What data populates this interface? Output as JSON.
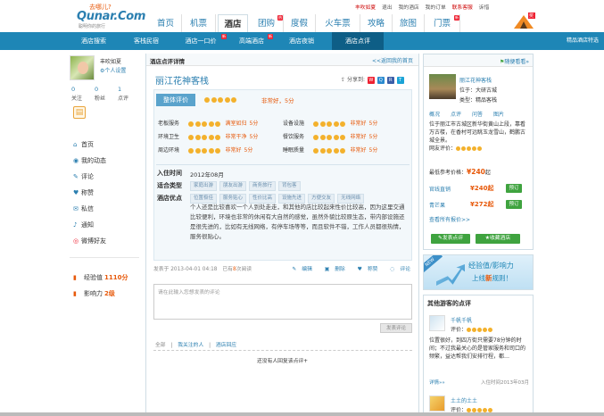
{
  "header": {
    "logo_small": "去哪儿?",
    "logo_main": "Qunar.Com",
    "logo_slogan": "聪明你的旅行",
    "top_links": [
      "丰吹如夏",
      "退出",
      "我的酒店",
      "我的订单",
      "联系客服",
      "诉惜"
    ],
    "nav": [
      {
        "label": "首页",
        "badge": ""
      },
      {
        "label": "机票",
        "badge": ""
      },
      {
        "label": "酒店",
        "badge": ""
      },
      {
        "label": "团购",
        "badge": "热"
      },
      {
        "label": "度假",
        "badge": ""
      },
      {
        "label": "火车票",
        "badge": ""
      },
      {
        "label": "攻略",
        "badge": ""
      },
      {
        "label": "旅图",
        "badge": ""
      },
      {
        "label": "门票",
        "badge": "新"
      }
    ],
    "tent_badge": "奖"
  },
  "subnav": {
    "items": [
      "酒店搜索",
      "客栈民宿",
      "酒店一口价",
      "高端酒店",
      "酒店夜销",
      "酒店点评"
    ],
    "badges": {
      "2": "新",
      "3": "新"
    },
    "right_link": "精品酒店特选"
  },
  "left": {
    "username": "丰吹如夏",
    "settings": "个人设置",
    "stats": [
      {
        "num": "0",
        "label": "关注"
      },
      {
        "num": "0",
        "label": "粉丝"
      },
      {
        "num": "1",
        "label": "点评"
      }
    ],
    "nav": [
      "首页",
      "我的动态",
      "评论",
      "称赞",
      "私信",
      "通知",
      "微博好友"
    ],
    "scores": [
      {
        "label": "经验值",
        "value": "1110分"
      },
      {
        "label": "影响力",
        "value": "2级"
      }
    ]
  },
  "main": {
    "title": "酒店点评详情",
    "back": "<<返回我的首页",
    "hotel_name": "丽江花神客栈",
    "share_label": "分享到:",
    "overall_label": "整体评价",
    "overall_text": "非常好，5分",
    "ratings": [
      {
        "label": "老板服务",
        "cmt": "满室如归",
        "score": "5分"
      },
      {
        "label": "设备设施",
        "cmt": "非常好",
        "score": "5分"
      },
      {
        "label": "环境卫生",
        "cmt": "非常干净",
        "score": "5分"
      },
      {
        "label": "餐饮服务",
        "cmt": "非常好",
        "score": "5分"
      },
      {
        "label": "周边环境",
        "cmt": "非常好",
        "score": "5分"
      },
      {
        "label": "睡眠质量",
        "cmt": "非常好",
        "score": "5分"
      }
    ],
    "checkin_label": "入住时间",
    "checkin_value": "2012年08月",
    "suitable_label": "适合类型",
    "suitable_tags": [
      "家庭出游",
      "朋友出游",
      "商务旅行",
      "背包客"
    ],
    "pros_label": "酒店优点",
    "pros_tags": [
      "位置极佳",
      "服务贴心",
      "性价比高",
      "设施先进",
      "方便交友",
      "无线网络"
    ],
    "review_text": "个人还是比较喜欢一个人到处走走，和其他的店比较起来性价比较高，因为这里交通比较便利，环境也非常的休闲有大自然的感觉，虽然外貌比较原生态，带内部设施还是很先进的，比如有无线网络，有停车场等等，而且软件不错，工作人员都很热情，服务很贴心。",
    "meta_published": "发表于 2013-04-01 04:18",
    "meta_views_prefix": "已有",
    "meta_views": "8",
    "meta_views_suffix": "次阅读",
    "actions": [
      "编辑",
      "删除",
      "称赞",
      "评论"
    ],
    "comment_placeholder": "请在此输入您想发表的评论",
    "submit": "发表评论",
    "filters": [
      "全部",
      "我关注的人",
      "酒店回应"
    ],
    "no_reply": "还没有人回复该点评+"
  },
  "right": {
    "head_left": "",
    "head_right": "随便看看»",
    "hotel": {
      "name": "丽江花神客栈",
      "location": "位于：大研古城",
      "type": "类型：精品客栈"
    },
    "tabs": [
      "概况",
      "点评",
      "问答",
      "图片"
    ],
    "desc": "位于丽江市古城区新华街黄山上段，靠看万古楼，在香村可远眺玉龙雪山，鹤鹏古城全景。",
    "desc_more": "网友评价：",
    "lowest_label": "最低参考价格：",
    "lowest_price": "¥240",
    "lowest_suffix": "起",
    "otas": [
      {
        "name": "官线直销",
        "price": "¥240起",
        "btn": "预订"
      },
      {
        "name": "青芒果",
        "price": "¥272起",
        "btn": "预订"
      }
    ],
    "more_price": "查看所有报价>>",
    "btn_review": "发表点评",
    "btn_fav": "收藏酒店",
    "banner_t1": "经验值/影响力",
    "banner_t2a": "上线",
    "banner_t2b": "新",
    "banner_t2c": "规则！",
    "banner_new": "NEW",
    "others_title": "其他游客的点评",
    "others": [
      {
        "name": "千帆千帆",
        "rate": "评价：",
        "text": "位置很好，到四方街只需要78分钟的时间；不过我最关心的是管家服务和司口的频繁，益达帮我们安排行程，都…",
        "foot_l": "详情»»",
        "foot_r": "入住时间2013年03月"
      },
      {
        "name": "土土的土土",
        "rate": "评价：",
        "text": "",
        "foot_l": "",
        "foot_r": ""
      }
    ]
  }
}
